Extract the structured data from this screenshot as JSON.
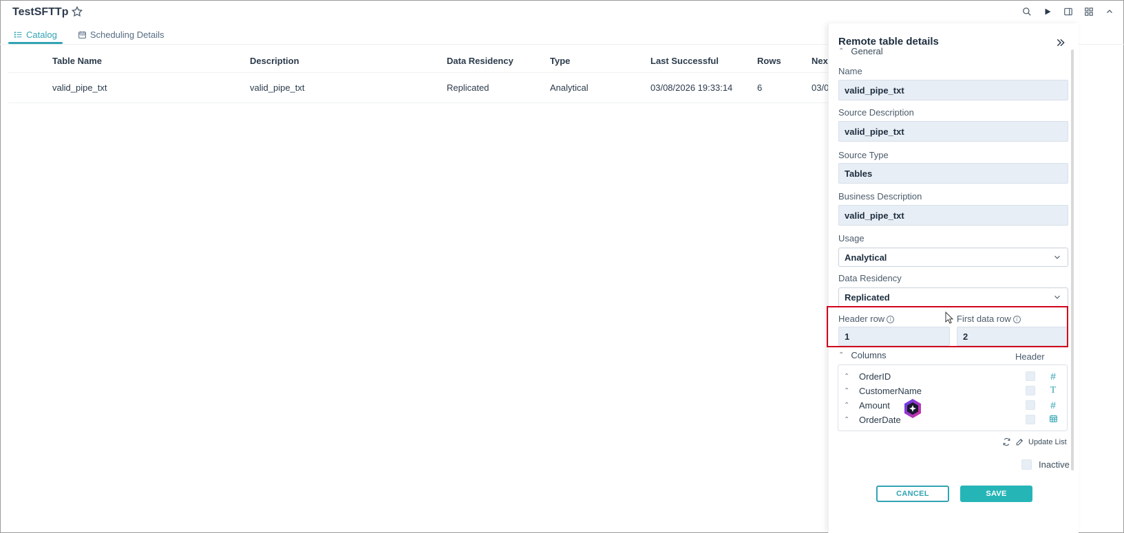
{
  "app": {
    "title": "TestSFTTp"
  },
  "tabs": [
    {
      "label": "Catalog",
      "icon": "list-icon",
      "active": true
    },
    {
      "label": "Scheduling Details",
      "icon": "calendar-icon",
      "active": false
    }
  ],
  "table": {
    "headers": [
      "Table Name",
      "Description",
      "Data Residency",
      "Type",
      "Last Successful",
      "Rows",
      "Next"
    ],
    "rows": [
      [
        "valid_pipe_txt",
        "valid_pipe_txt",
        "Replicated",
        "Analytical",
        "03/08/2026 19:33:14",
        "6",
        "03/0"
      ]
    ]
  },
  "panel": {
    "title": "Remote table details",
    "general_label": "General",
    "name_label": "Name",
    "name_value": "valid_pipe_txt",
    "source_description_label": "Source Description",
    "source_description_value": "valid_pipe_txt",
    "source_type_label": "Source Type",
    "source_type_value": "Tables",
    "business_description_label": "Business Description",
    "business_description_value": "valid_pipe_txt",
    "usage_label": "Usage",
    "usage_value": "Analytical",
    "data_residency_label": "Data Residency",
    "data_residency_value": "Replicated",
    "header_row_label": "Header row",
    "header_row_value": "1",
    "first_data_row_label": "First data row",
    "first_data_row_value": "2",
    "columns_label": "Columns",
    "header_col_label": "Header",
    "columns": [
      {
        "name": "OrderID",
        "type_icon": "#"
      },
      {
        "name": "CustomerName",
        "type_icon": "T"
      },
      {
        "name": "Amount",
        "type_icon": "#"
      },
      {
        "name": "OrderDate",
        "type_icon": "calendar"
      }
    ],
    "update_list_label": "Update List",
    "inactive_label": "Inactive",
    "cancel_label": "CANCEL",
    "save_label": "SAVE"
  },
  "colors": {
    "accent": "#31a3b3",
    "save": "#26b5b7",
    "highlight": "#d0021b"
  }
}
